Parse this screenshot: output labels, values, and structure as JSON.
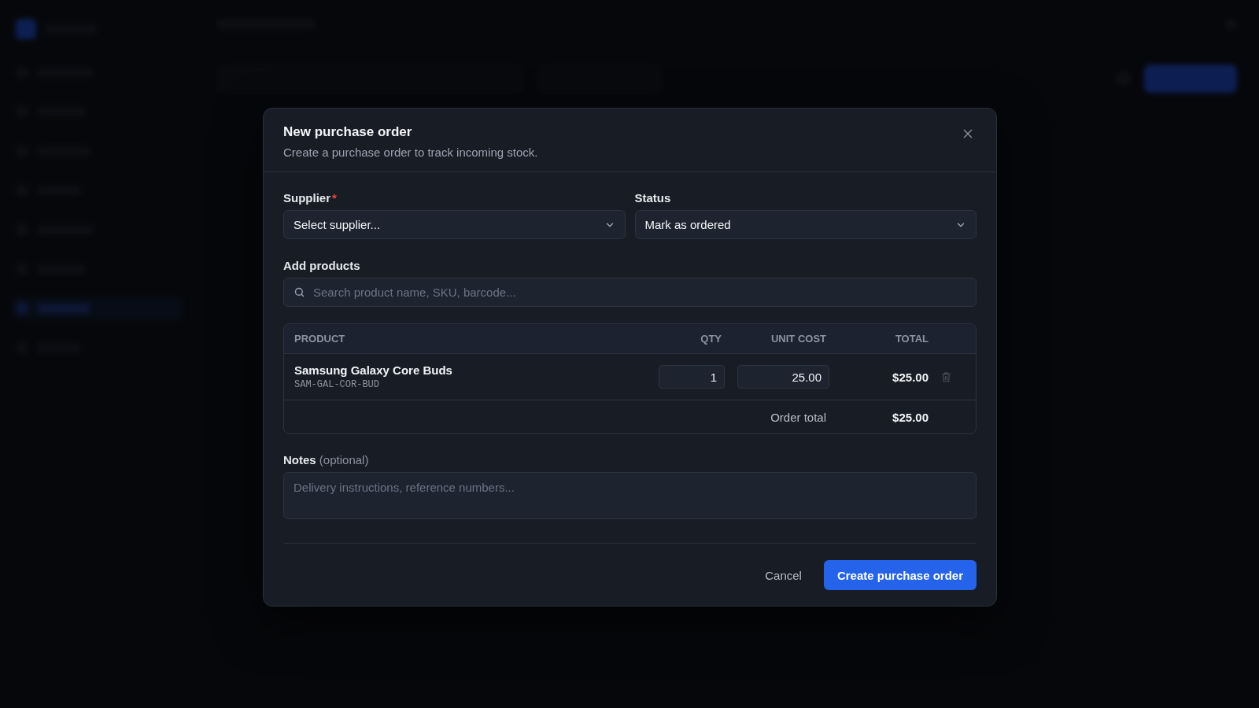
{
  "dialog": {
    "title": "New purchase order",
    "subtitle": "Create a purchase order to track incoming stock.",
    "supplier": {
      "label": "Supplier",
      "required_mark": "*",
      "value": "Select supplier..."
    },
    "status": {
      "label": "Status",
      "value": "Mark as ordered"
    },
    "add_products": {
      "label": "Add products",
      "placeholder": "Search product name, SKU, barcode..."
    },
    "table": {
      "columns": [
        "PRODUCT",
        "QTY",
        "UNIT COST",
        "TOTAL"
      ],
      "rows": [
        {
          "name": "Samsung Galaxy Core Buds",
          "sku": "SAM-GAL-COR-BUD",
          "qty": "1",
          "unit_cost": "25.00",
          "total": "$25.00"
        }
      ],
      "footer": {
        "label": "Order total",
        "value": "$25.00"
      }
    },
    "notes": {
      "label": "Notes",
      "hint": "(optional)",
      "placeholder": "Delivery instructions, reference numbers..."
    },
    "buttons": {
      "cancel": "Cancel",
      "submit": "Create purchase order"
    }
  }
}
